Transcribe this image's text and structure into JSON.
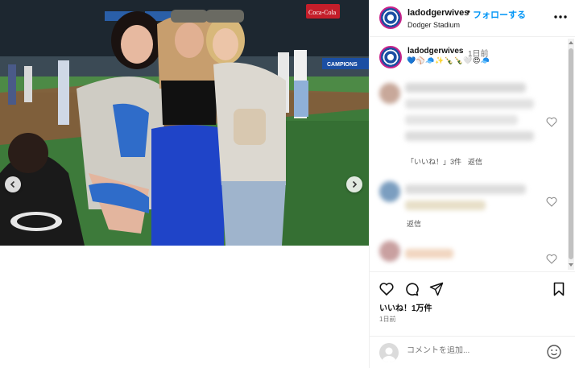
{
  "post": {
    "username": "ladodgerwives",
    "follow_label": "フォローする",
    "location": "Dodger Stadium",
    "caption_time": "1日前",
    "caption_emojis": "💙⚾🧢✨🍾🍾🤍😍🧢",
    "likes": "いいね！1万件",
    "posted_time": "1日前",
    "comment_placeholder": "コメントを追加..."
  },
  "comments": [
    {
      "likes_label": "「いいね！」3件",
      "reply_label": "返信"
    },
    {
      "reply_label": "返信"
    }
  ],
  "media": {
    "stadium_sign": "CAMPIONS",
    "coke_sign": "Coca-Cola"
  },
  "colors": {
    "accent": "#0095f6",
    "dodger_blue": "#1b4fa3"
  }
}
